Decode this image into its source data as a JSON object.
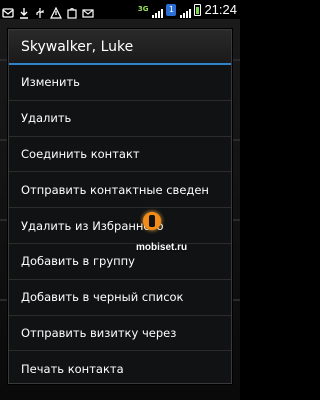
{
  "status_bar": {
    "network_label": "3G",
    "time": "21:24",
    "colors": {
      "network": "#9be35a",
      "battery": "#7bd94b",
      "notif_badge": "#2b6fd6"
    },
    "notification_icons": [
      "sms-icon",
      "download-icon",
      "usb-icon",
      "alert-icon",
      "market-icon",
      "mail-icon"
    ],
    "notification_badge": "1"
  },
  "dialog": {
    "title": "Skywalker, Luke",
    "accent_color": "#2f83c6",
    "items": [
      {
        "label": "Изменить"
      },
      {
        "label": "Удалить"
      },
      {
        "label": "Соединить контакт"
      },
      {
        "label": "Отправить контактные сведен"
      },
      {
        "label": "Удалить из Избранного"
      },
      {
        "label": "Добавить в группу"
      },
      {
        "label": "Добавить в черный список"
      },
      {
        "label": "Отправить визитку через"
      },
      {
        "label": "Печать контакта"
      }
    ]
  },
  "watermark": {
    "text": "mobiset.ru"
  }
}
